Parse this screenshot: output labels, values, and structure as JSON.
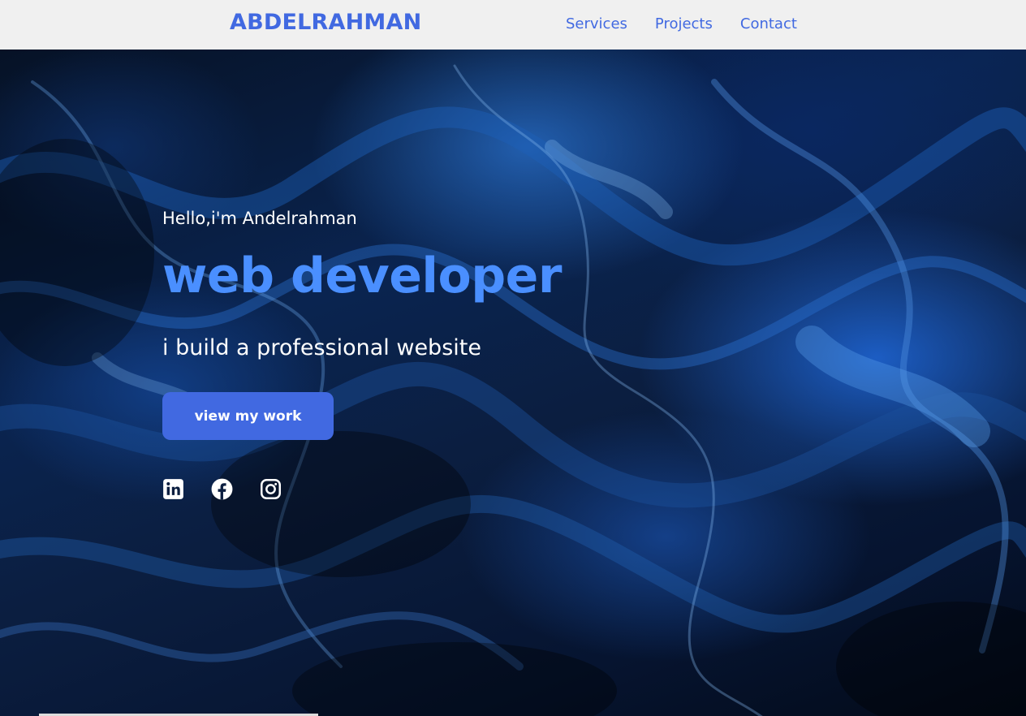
{
  "nav": {
    "brand": "ABDELRAHMAN",
    "links": [
      {
        "label": "Services"
      },
      {
        "label": "Projects"
      },
      {
        "label": "Contact"
      }
    ]
  },
  "hero": {
    "greeting": "Hello,i'm Andelrahman",
    "role": "web developer",
    "tagline": "i build a professional website",
    "cta_label": "view my work",
    "socials": [
      {
        "icon": "linkedin-icon"
      },
      {
        "icon": "facebook-icon"
      },
      {
        "icon": "instagram-icon"
      }
    ]
  },
  "colors": {
    "accent": "#4169e1",
    "role_text": "#4a8fff",
    "nav_bg": "#f0f0f0"
  }
}
